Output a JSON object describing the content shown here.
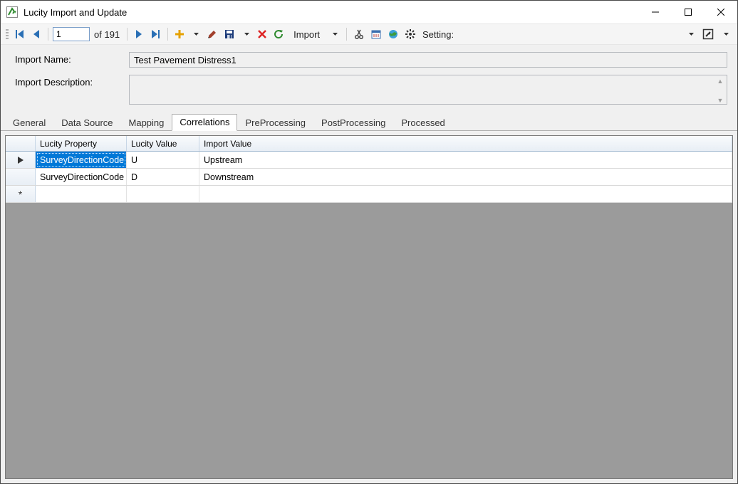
{
  "window": {
    "title": "Lucity Import and Update"
  },
  "toolbar": {
    "page_current": "1",
    "page_total_prefix": "of ",
    "page_total": "191",
    "import_label": "Import",
    "setting_label": "Setting:"
  },
  "form": {
    "name_label": "Import Name:",
    "name_value": "Test Pavement Distress1",
    "desc_label": "Import Description:",
    "desc_value": ""
  },
  "tabs": {
    "items": [
      {
        "label": "General"
      },
      {
        "label": "Data Source"
      },
      {
        "label": "Mapping"
      },
      {
        "label": "Correlations"
      },
      {
        "label": "PreProcessing"
      },
      {
        "label": "PostProcessing"
      },
      {
        "label": "Processed"
      }
    ],
    "active_index": 3
  },
  "grid": {
    "headers": {
      "lucity_property": "Lucity Property",
      "lucity_value": "Lucity Value",
      "import_value": "Import Value"
    },
    "rows": [
      {
        "selector": "current",
        "property": "SurveyDirectionCode",
        "lucity_value": "U",
        "import_value": "Upstream"
      },
      {
        "selector": "",
        "property": "SurveyDirectionCode",
        "lucity_value": "D",
        "import_value": "Downstream"
      },
      {
        "selector": "new",
        "property": "",
        "lucity_value": "",
        "import_value": ""
      }
    ]
  }
}
